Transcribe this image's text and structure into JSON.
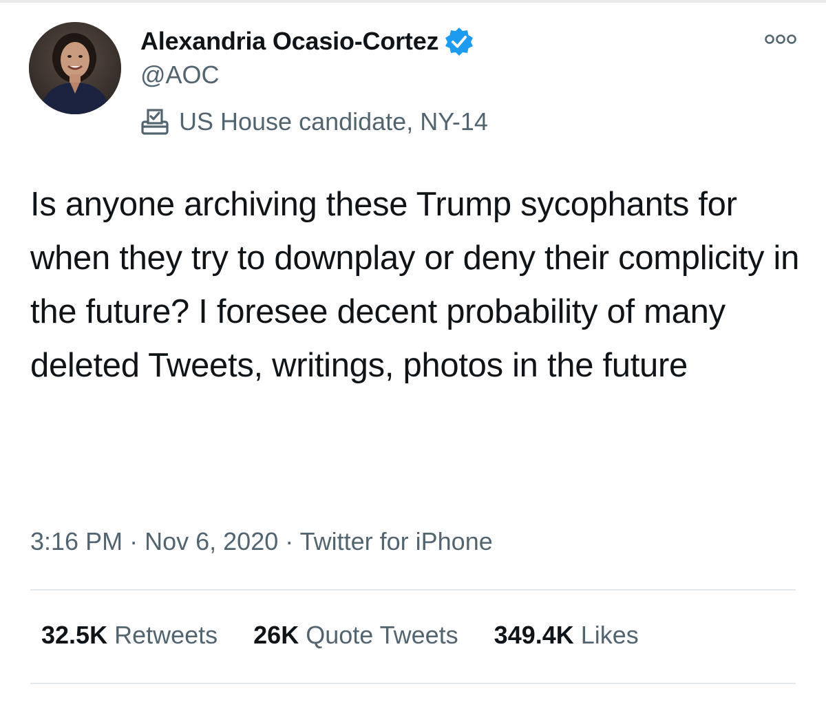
{
  "tweet": {
    "author": {
      "display_name": "Alexandria Ocasio-Cortez",
      "handle": "@AOC",
      "verified_icon": "verified-badge-icon",
      "label_icon": "ballot-box-icon",
      "label": "US House candidate, NY-14"
    },
    "more_icon": "more-options-icon",
    "text": "Is anyone archiving these Trump sycophants for when they try to downplay or deny their complicity in the future? I foresee decent probability of many deleted Tweets, writings, photos in the future",
    "time": "3:16 PM",
    "separator": "·",
    "date": "Nov 6, 2020",
    "source": "Twitter for iPhone",
    "stats": {
      "retweets_count": "32.5K",
      "retweets_label": "Retweets",
      "quotes_count": "26K",
      "quotes_label": "Quote Tweets",
      "likes_count": "349.4K",
      "likes_label": "Likes"
    }
  },
  "colors": {
    "primary_text": "#0f1419",
    "secondary_text": "#536471",
    "verified_blue": "#1d9bf0",
    "divider": "#e4e7ea"
  }
}
